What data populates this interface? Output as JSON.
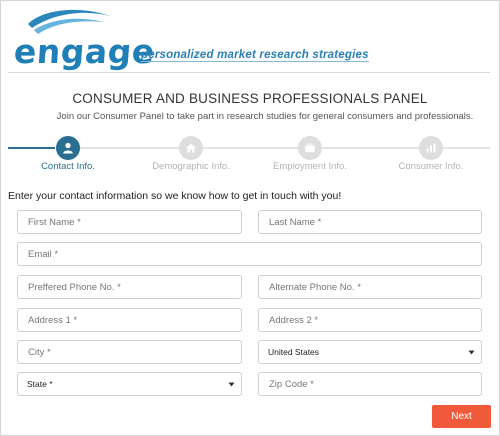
{
  "header": {
    "logo_text": "engage",
    "tagline": "personalized market research strategies"
  },
  "panel": {
    "title": "CONSUMER AND BUSINESS PROFESSIONALS PANEL",
    "subtitle": "Join our Consumer Panel to take part in research studies for general consumers and professionals."
  },
  "steps": [
    {
      "label": "Contact Info.",
      "icon": "user-icon",
      "active": true
    },
    {
      "label": "Demographic Info.",
      "icon": "home-icon",
      "active": false
    },
    {
      "label": "Employment Info.",
      "icon": "briefcase-icon",
      "active": false
    },
    {
      "label": "Consumer Info.",
      "icon": "bar-chart-icon",
      "active": false
    }
  ],
  "form": {
    "intro": "Enter your contact information so we know how to get in touch with you!",
    "first_name": {
      "placeholder": "First Name *",
      "value": ""
    },
    "last_name": {
      "placeholder": "Last Name *",
      "value": ""
    },
    "email": {
      "placeholder": "Email *",
      "value": ""
    },
    "phone": {
      "placeholder": "Preffered Phone No. *",
      "value": ""
    },
    "alt_phone": {
      "placeholder": "Alternate Phone No. *",
      "value": ""
    },
    "address1": {
      "placeholder": "Address 1 *",
      "value": ""
    },
    "address2": {
      "placeholder": "Address 2 *",
      "value": ""
    },
    "city": {
      "placeholder": "City *",
      "value": ""
    },
    "country": {
      "selected": "United States"
    },
    "state": {
      "selected": "State *"
    },
    "zip": {
      "placeholder": "Zip Code *",
      "value": ""
    }
  },
  "actions": {
    "next_label": "Next"
  },
  "colors": {
    "brand": "#1f7fb6",
    "active_step": "#2a6f92",
    "inactive": "#dedede",
    "next_button": "#f05a3b"
  }
}
